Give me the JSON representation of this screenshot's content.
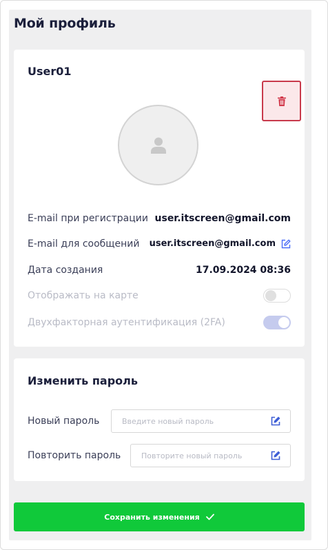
{
  "page": {
    "title": "Мой профиль"
  },
  "profile": {
    "username": "User01",
    "delete_icon": "trash-icon",
    "avatar_icon": "user-icon",
    "fields": {
      "registration_email_label": "E-mail при регистрации",
      "registration_email_value": "user.itscreen@gmail.com",
      "messages_email_label": "E-mail для сообщений",
      "messages_email_value": "user.itscreen@gmail.com",
      "created_label": "Дата создания",
      "created_value": "17.09.2024 08:36",
      "show_on_map_label": "Отображать на карте",
      "show_on_map_enabled": false,
      "two_factor_label": "Двухфакторная аутентификация (2FA)",
      "two_factor_enabled": true
    }
  },
  "password": {
    "title": "Изменить пароль",
    "new_label": "Новый пароль",
    "new_placeholder": "Введите новый пароль",
    "repeat_label": "Повторить пароль",
    "repeat_placeholder": "Повторите новый пароль"
  },
  "actions": {
    "save_label": "Сохранить изменения",
    "save_icon": "check-icon"
  },
  "colors": {
    "accent": "#4a6cf7",
    "danger": "#c8394b",
    "success": "#10c93a"
  }
}
